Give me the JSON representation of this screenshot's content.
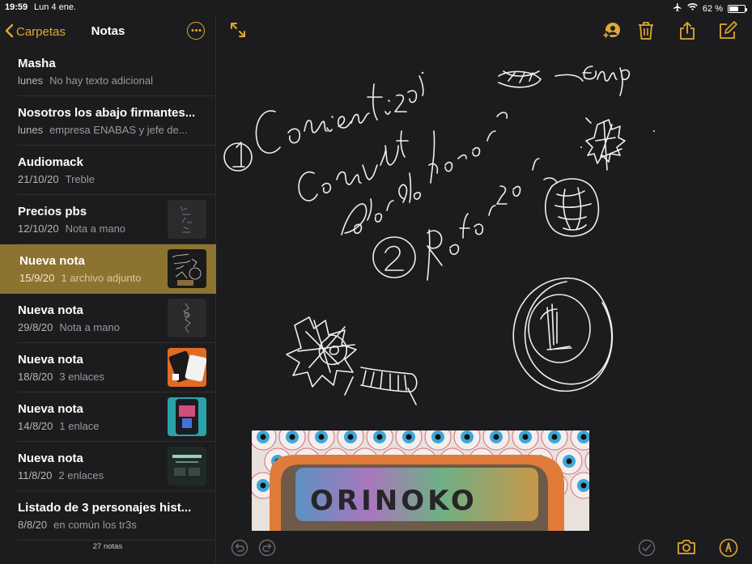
{
  "status_bar": {
    "time": "19:59",
    "date": "Lun 4 ene.",
    "battery_percent": "62 %",
    "battery_level": 0.62
  },
  "sidebar": {
    "back_label": "Carpetas",
    "title": "Notas",
    "more_icon": "ellipsis-circle-icon",
    "notes": [
      {
        "title": "Masha",
        "date": "lunes",
        "preview": "No hay texto adicional",
        "thumbnail": null,
        "selected": false
      },
      {
        "title": "Nosotros los abajo firmantes...",
        "date": "lunes",
        "preview": "empresa ENABAS y jefe de...",
        "thumbnail": null,
        "selected": false
      },
      {
        "title": "Audiomack",
        "date": "21/10/20",
        "preview": "Treble",
        "thumbnail": null,
        "selected": false
      },
      {
        "title": "Precios pbs",
        "date": "12/10/20",
        "preview": "Nota a mano",
        "thumbnail": "handwriting-dark",
        "selected": false
      },
      {
        "title": "Nueva nota",
        "date": "15/9/20",
        "preview": "1 archivo adjunto",
        "thumbnail": "drawing-dark",
        "selected": true
      },
      {
        "title": "Nueva nota",
        "date": "29/8/20",
        "preview": "Nota a mano",
        "thumbnail": "sketch-dark",
        "selected": false
      },
      {
        "title": "Nueva nota",
        "date": "18/8/20",
        "preview": "3 enlaces",
        "thumbnail": "app-orange",
        "selected": false
      },
      {
        "title": "Nueva nota",
        "date": "14/8/20",
        "preview": "1 enlace",
        "thumbnail": "app-teal",
        "selected": false
      },
      {
        "title": "Nueva nota",
        "date": "11/8/20",
        "preview": "2 enlaces",
        "thumbnail": "web-dark",
        "selected": false
      },
      {
        "title": "Listado de 3 personajes hist...",
        "date": "8/8/20",
        "preview": "en común los tr3s",
        "thumbnail": null,
        "selected": false
      }
    ],
    "count_label": "27 notas"
  },
  "toolbar": {
    "expand_icon": "expand-arrows-icon",
    "share_person_icon": "add-person-circle-icon",
    "trash_icon": "trash-icon",
    "share_icon": "share-icon",
    "compose_icon": "compose-icon"
  },
  "bottom_toolbar": {
    "undo_icon": "undo-icon",
    "redo_icon": "redo-icon",
    "checklist_icon": "checkmark-circle-icon",
    "camera_icon": "camera-icon",
    "markup_icon": "pen-circle-icon"
  },
  "colors": {
    "accent": "#e0a92f",
    "selected_row": "#8c7330",
    "background": "#1c1c1e"
  }
}
